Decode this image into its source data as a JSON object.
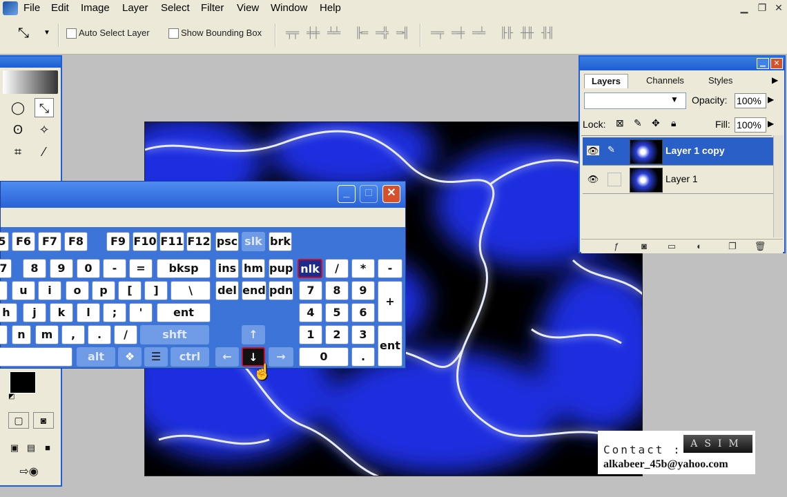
{
  "menubar": {
    "items": [
      "File",
      "Edit",
      "Image",
      "Layer",
      "Select",
      "Filter",
      "View",
      "Window",
      "Help"
    ]
  },
  "options": {
    "auto_select_label": "Auto Select Layer",
    "bounding_box_label": "Show Bounding Box"
  },
  "osk": {
    "row_fn": [
      "5",
      "F6",
      "F7",
      "F8",
      "F9",
      "F10",
      "F11",
      "F12",
      "psc",
      "slk",
      "brk"
    ],
    "row_num": [
      "7",
      "8",
      "9",
      "0",
      "-",
      "=",
      "bksp"
    ],
    "row_nav1": [
      "ins",
      "hm",
      "pup"
    ],
    "row_q": [
      "u",
      "i",
      "o",
      "p",
      "[",
      "]",
      "\\"
    ],
    "row_nav2": [
      "del",
      "end",
      "pdn"
    ],
    "row_a": [
      "h",
      "j",
      "k",
      "l",
      ";",
      "'",
      "ent"
    ],
    "row_z": [
      "n",
      "m",
      ",",
      ".",
      "/",
      "shft"
    ],
    "row_bottom": [
      "alt",
      "ctrl"
    ],
    "arrows": {
      "up": "↑",
      "left": "←",
      "down": "↓",
      "right": "→"
    },
    "numpad": {
      "r1": [
        "nlk",
        "/",
        "*",
        "-"
      ],
      "r2": [
        "7",
        "8",
        "9"
      ],
      "plus": "+",
      "r3": [
        "4",
        "5",
        "6"
      ],
      "r4": [
        "1",
        "2",
        "3"
      ],
      "zero": "0",
      "dot": ".",
      "ent": "ent"
    }
  },
  "layers_panel": {
    "tabs": [
      "Layers",
      "Channels",
      "Styles"
    ],
    "opacity_label": "Opacity:",
    "opacity_value": "100%",
    "lock_label": "Lock:",
    "fill_label": "Fill:",
    "fill_value": "100%",
    "layers": [
      {
        "name": "Layer 1 copy",
        "selected": true
      },
      {
        "name": "Layer 1",
        "selected": false
      }
    ]
  },
  "watermark": {
    "contact_label": "Contact :",
    "brand": "ASIM",
    "email": "alkabeer_45b@yahoo.com"
  },
  "colors": {
    "xp_blue": "#3d74d8",
    "selection_blue": "#2b5fc8",
    "highlight_red": "#c8102e"
  }
}
